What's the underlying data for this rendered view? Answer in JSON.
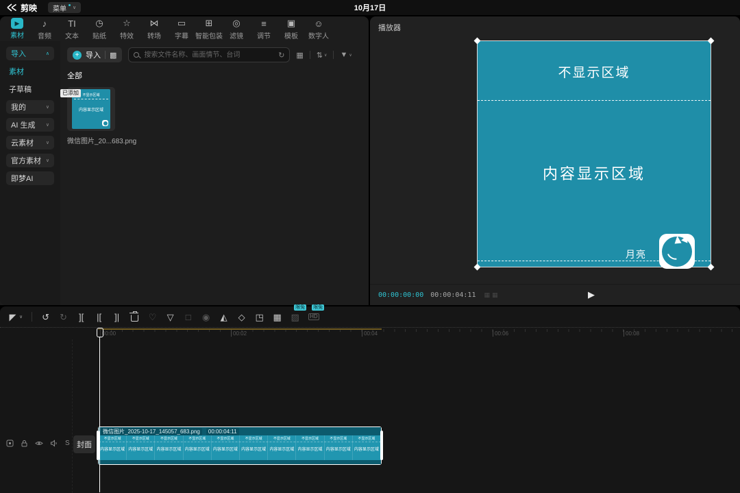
{
  "colors": {
    "accent_teal": "#29b7c7",
    "preview_teal": "#1f8ea8",
    "clip_band_teal": "#0c5b6e",
    "timeline_range_olive": "#6e5a20",
    "added_badge_bg": "#ebebeb",
    "free_badge_bg": "#3ec8d6"
  },
  "icons": {
    "plus": "+",
    "qr": "▩",
    "layout_grid": "▦",
    "sort": "⇅",
    "filter": "▼",
    "chev_down": "∨",
    "refresh": "↻",
    "play": "▶",
    "frame_grid_a": "▦",
    "frame_grid_b": "▦"
  },
  "topbar": {
    "app_name": "剪映",
    "menu_label": "菜单",
    "date": "10月17日"
  },
  "ribbon": {
    "tabs": [
      {
        "name": "tab-media",
        "label": "素材",
        "glyph": "▶",
        "classes": "selected"
      },
      {
        "name": "tab-audio",
        "label": "音频",
        "glyph": "♪"
      },
      {
        "name": "tab-text",
        "label": "文本",
        "glyph": "TI"
      },
      {
        "name": "tab-sticker",
        "label": "贴纸",
        "glyph": "◷"
      },
      {
        "name": "tab-effects",
        "label": "特效",
        "glyph": "☆"
      },
      {
        "name": "tab-transition",
        "label": "转场",
        "glyph": "⋈"
      },
      {
        "name": "tab-captions",
        "label": "字幕",
        "glyph": "▭"
      },
      {
        "name": "tab-smart-pack",
        "label": "智能包装",
        "glyph": "⊞"
      },
      {
        "name": "tab-filters",
        "label": "滤镜",
        "glyph": "◎"
      },
      {
        "name": "tab-adjust",
        "label": "调节",
        "glyph": "≡"
      },
      {
        "name": "tab-templates",
        "label": "模板",
        "glyph": "▣"
      },
      {
        "name": "tab-avatar",
        "label": "数字人",
        "glyph": "☺"
      }
    ]
  },
  "sidebar": {
    "items": [
      {
        "name": "sidebar-item-import",
        "label": "导入",
        "chev": "∧",
        "classes": "pill accent"
      },
      {
        "name": "sidebar-item-media",
        "label": "素材",
        "chev": "",
        "classes": "plain accent"
      },
      {
        "name": "sidebar-item-subdraft",
        "label": "子草稿",
        "chev": "",
        "classes": "plain"
      },
      {
        "name": "sidebar-item-mine",
        "label": "我的",
        "chev": "∨",
        "classes": "pill"
      },
      {
        "name": "sidebar-item-ai",
        "label": "AI 生成",
        "chev": "∨",
        "classes": "pill"
      },
      {
        "name": "sidebar-item-cloud",
        "label": "云素材",
        "chev": "∨",
        "classes": "pill"
      },
      {
        "name": "sidebar-item-official",
        "label": "官方素材",
        "chev": "∨",
        "classes": "pill"
      },
      {
        "name": "sidebar-item-jimeng",
        "label": "即梦AI",
        "chev": "",
        "classes": "pill"
      }
    ]
  },
  "media": {
    "import_label": "导入",
    "search_placeholder": "搜索文件名称、画面情节、台词",
    "all_label": "全部",
    "item": {
      "added_badge": "已添加",
      "filename": "微信图片_20...683.png",
      "preview_top": "不显示区域",
      "preview_mid": "内容显示区域"
    }
  },
  "player": {
    "title": "播放器",
    "preview": {
      "top_label": "不显示区域",
      "mid_label": "内容显示区域",
      "watermark_text": "月亮"
    },
    "current_time": "00:00:00:00",
    "duration": "00:00:04:11"
  },
  "timeline": {
    "tools": [
      {
        "name": "select-tool-icon",
        "glyph": "◤"
      },
      {
        "name": "select-tool-chevron",
        "glyph": "∨",
        "classes": "chev"
      },
      {
        "name": "toolbar-divider",
        "glyph": "",
        "classes": "divider"
      },
      {
        "name": "undo-icon",
        "glyph": "↺"
      },
      {
        "name": "redo-icon",
        "glyph": "↻",
        "classes": "dim"
      },
      {
        "name": "split-icon",
        "glyph": "]["
      },
      {
        "name": "delete-left-icon",
        "glyph": "|["
      },
      {
        "name": "delete-right-icon",
        "glyph": "]|"
      },
      {
        "name": "delete-icon",
        "glyph": "",
        "classes": "css-trash"
      },
      {
        "name": "freeze-frame-icon",
        "glyph": "♡",
        "classes": "dim"
      },
      {
        "name": "mask-icon",
        "glyph": "▽"
      },
      {
        "name": "smart-split-icon",
        "glyph": "□",
        "classes": "dim"
      },
      {
        "name": "loop-play-icon",
        "glyph": "◉",
        "classes": "dim"
      },
      {
        "name": "mirror-icon",
        "glyph": "◭"
      },
      {
        "name": "rotate-icon",
        "glyph": "◇"
      },
      {
        "name": "crop-icon",
        "glyph": "◳"
      },
      {
        "name": "transform-icon",
        "glyph": "▦"
      },
      {
        "name": "smart-matting-icon",
        "glyph": "▨",
        "classes": "dim",
        "badge": "限免"
      },
      {
        "name": "hd-enhance-icon",
        "glyph": "HD",
        "classes": "dim hd",
        "badge": "限免"
      }
    ],
    "ruler": [
      {
        "t": "00:00"
      },
      {
        "t": "00:02"
      },
      {
        "t": "00:04"
      },
      {
        "t": "00:06"
      },
      {
        "t": "00:08"
      }
    ],
    "cover_label": "封面",
    "solo_label": "S",
    "clip": {
      "name": "微信图片_2025-10-17_145057_683.png",
      "duration": "00:00:04:11",
      "tiles": {
        "count": 10,
        "top": "不显示区域",
        "mid": "内容显示区域"
      }
    }
  }
}
